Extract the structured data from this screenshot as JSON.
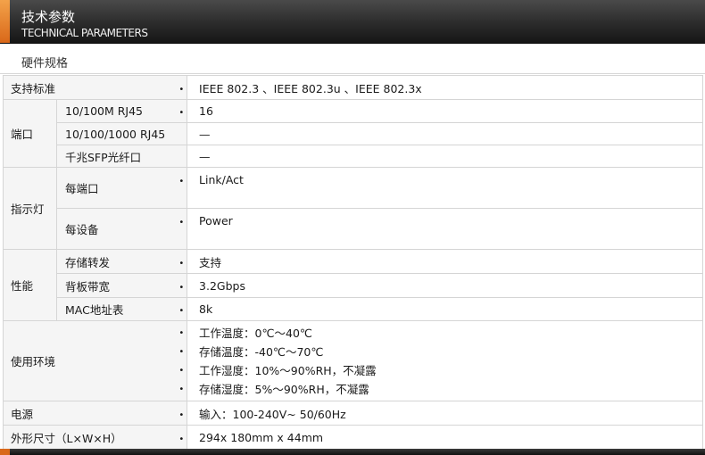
{
  "header": {
    "title_cn": "技术参数",
    "title_en": "TECHNICAL PARAMETERS",
    "accent_color": "#e07a24",
    "bar_color": "#2b2b2b"
  },
  "section": {
    "title": "硬件规格"
  },
  "bullet": "•",
  "rows": {
    "standard": {
      "label": "支持标准",
      "value": "IEEE 802.3 、IEEE 802.3u 、IEEE 802.3x"
    },
    "ports": {
      "label": "端口",
      "items": [
        {
          "label": "10/100M RJ45",
          "value": "16",
          "has_bullet": true
        },
        {
          "label": "10/100/1000 RJ45",
          "value": "—",
          "has_bullet": false
        },
        {
          "label": "千兆SFP光纤口",
          "value": "—",
          "has_bullet": false
        }
      ]
    },
    "indicator": {
      "label": "指示灯",
      "items": [
        {
          "label": "每端口",
          "value": "Link/Act"
        },
        {
          "label": "每设备",
          "value": "Power"
        }
      ]
    },
    "performance": {
      "label": "性能",
      "items": [
        {
          "label": "存储转发",
          "value": "支持"
        },
        {
          "label": "背板带宽",
          "value": "3.2Gbps"
        },
        {
          "label": "MAC地址表",
          "value": "8k"
        }
      ]
    },
    "environment": {
      "label": "使用环境",
      "values": [
        "工作温度：0℃～40℃",
        "存储温度：-40℃～70℃",
        "工作湿度：10%～90%RH，不凝露",
        "存储湿度：5%～90%RH，不凝露"
      ]
    },
    "power": {
      "label": "电源",
      "value": "输入：100-240V~ 50/60Hz"
    },
    "dimensions": {
      "label": "外形尺寸（L×W×H）",
      "value": "294x 180mm x 44mm"
    }
  }
}
